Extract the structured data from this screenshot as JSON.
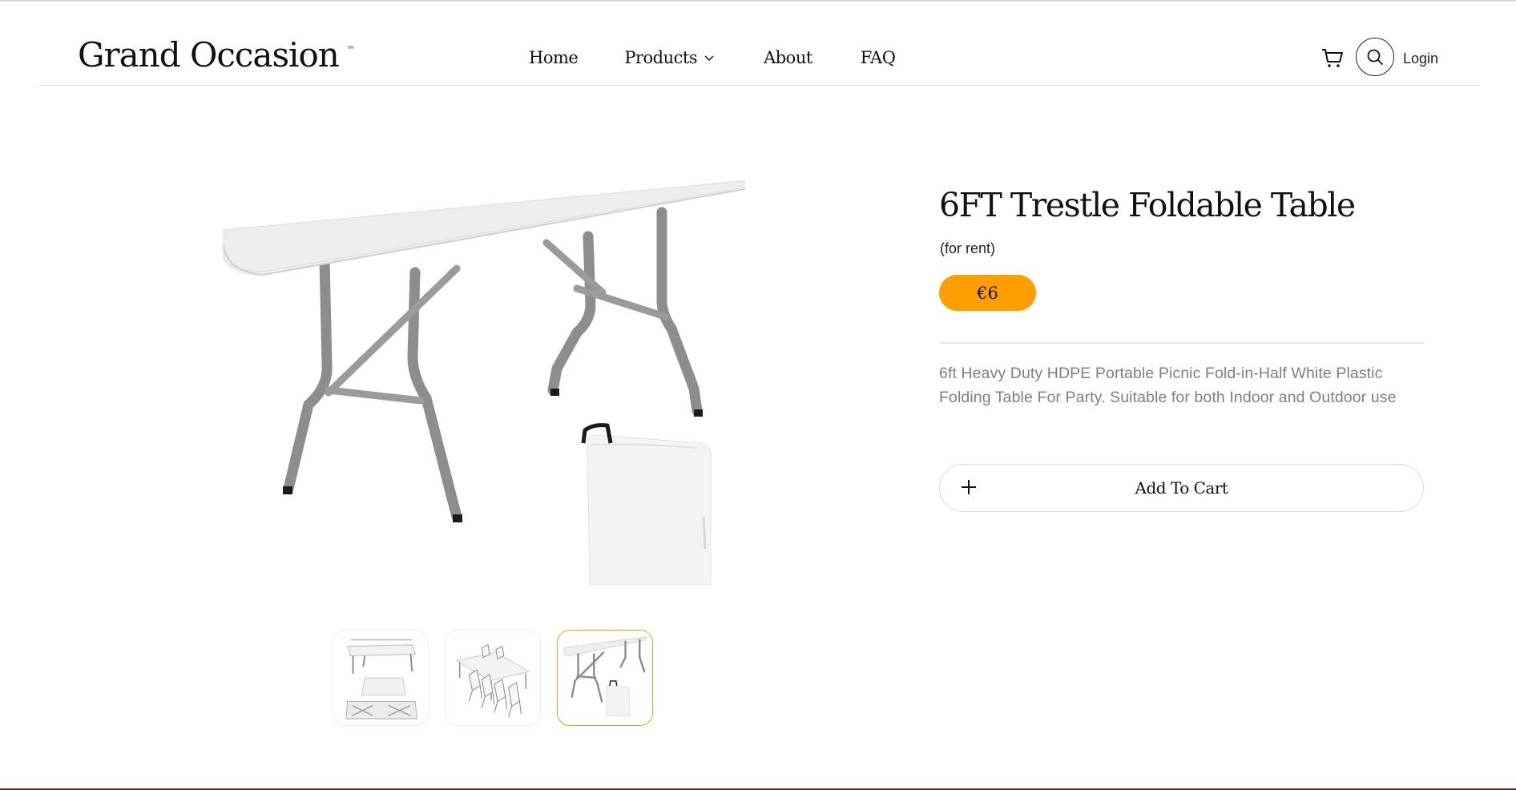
{
  "brand": {
    "name": "Grand Occasion",
    "tm": "™"
  },
  "nav": {
    "home": "Home",
    "products": "Products",
    "about": "About",
    "faq": "FAQ"
  },
  "header_actions": {
    "login": "Login",
    "cart_icon": "cart-icon",
    "search_icon": "search-icon"
  },
  "product": {
    "title": "6FT Trestle Foldable Table",
    "subtitle": "(for rent)",
    "price": "€6",
    "description": "6ft Heavy Duty HDPE Portable Picnic Fold-in-Half White Plastic Folding Table For Party. Suitable for both Indoor and Outdoor use",
    "add_to_cart": "Add To Cart"
  },
  "gallery": {
    "thumbnail_count": 3,
    "active_thumbnail": 3
  },
  "colors": {
    "accent": "#ff9e00",
    "thumb_active_border": "#f0a21a",
    "text": "#111111",
    "muted_text": "#808080",
    "footer_line": "#7a1f1f"
  }
}
